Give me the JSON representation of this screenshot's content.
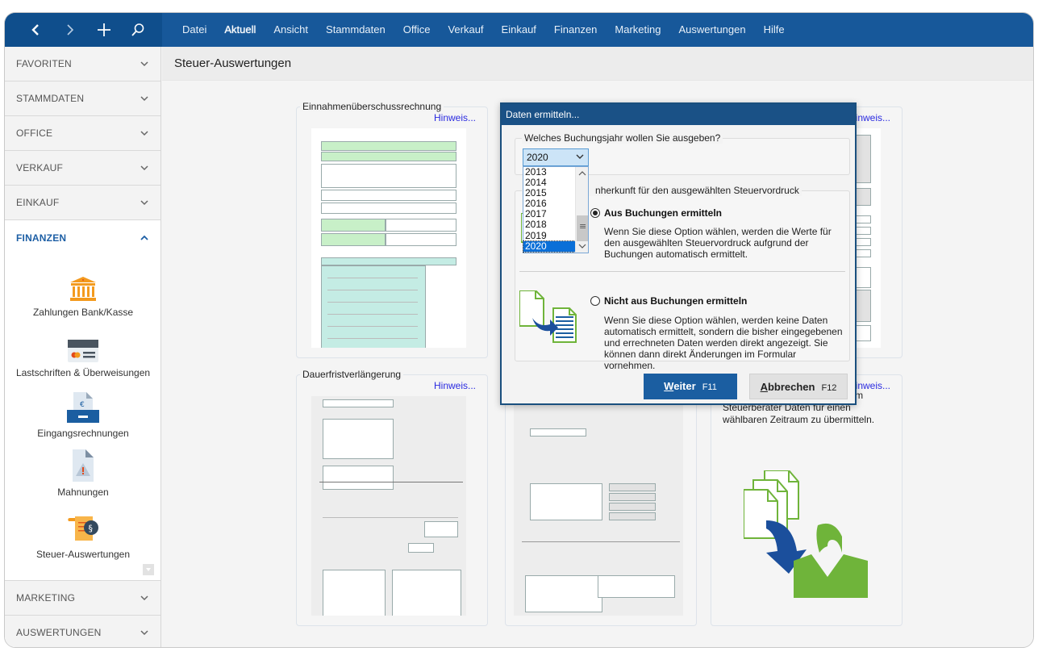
{
  "toolbar": {
    "nav_icons": [
      "back-icon",
      "forward-icon",
      "plus-icon",
      "search-icon"
    ],
    "menu": [
      "Datei",
      "Aktuell",
      "Ansicht",
      "Stammdaten",
      "Office",
      "Verkauf",
      "Einkauf",
      "Finanzen",
      "Marketing",
      "Auswertungen",
      "Hilfe"
    ],
    "active_menu": "Aktuell"
  },
  "sidebar": {
    "sections_top": [
      {
        "label": "FAVORITEN",
        "state": "collapsed"
      },
      {
        "label": "STAMMDATEN",
        "state": "collapsed"
      },
      {
        "label": "OFFICE",
        "state": "collapsed"
      },
      {
        "label": "VERKAUF",
        "state": "collapsed"
      },
      {
        "label": "EINKAUF",
        "state": "collapsed"
      }
    ],
    "open_section": {
      "label": "FINANZEN",
      "state": "expanded"
    },
    "finance_items": [
      {
        "label": "Zahlungen Bank/Kasse",
        "icon": "bank-icon"
      },
      {
        "label": "Lastschriften & Überweisungen",
        "icon": "credit-card-icon"
      },
      {
        "label": "Eingangsrechnungen",
        "icon": "invoice-inbox-icon"
      },
      {
        "label": "Mahnungen",
        "icon": "warning-document-icon"
      },
      {
        "label": "Steuer-Auswertungen",
        "icon": "tax-scroll-icon"
      }
    ],
    "sections_bottom": [
      {
        "label": "MARKETING",
        "state": "collapsed"
      },
      {
        "label": "AUSWERTUNGEN",
        "state": "collapsed"
      }
    ]
  },
  "page": {
    "title": "Steuer-Auswertungen",
    "cards": [
      {
        "title": "Einnahmenüberschussrechnung",
        "hint": "Hinweis..."
      },
      {
        "title": "",
        "hint": "Hinweis..."
      },
      {
        "title": "Dauerfristverlängerung",
        "hint": "Hinweis..."
      },
      {
        "title": "",
        "hint": ""
      },
      {
        "title": "",
        "hint": "Hinweis...",
        "text": "haben Sie die Möglichkeit, Ihrem Steuerberater Daten für einen wählbaren Zeitraum zu übermitteln.",
        "text_partial_hidden": "…er"
      }
    ]
  },
  "dialog": {
    "title": "Daten ermitteln...",
    "year_group_label": "Welches Buchungsjahr wollen Sie ausgeben?",
    "year_selected": "2020",
    "year_options": [
      "2013",
      "2014",
      "2015",
      "2016",
      "2017",
      "2018",
      "2019",
      "2020"
    ],
    "source_group_label": "Datenherkunft für den ausgewählten Steuervordruck",
    "source_group_label_visible": "nherkunft für den ausgewählten Steuervordruck",
    "source_group_label_prefix": "A",
    "option1": {
      "label": "Aus Buchungen ermitteln",
      "selected": true,
      "description": "Wenn Sie diese Option wählen, werden die Werte für den ausgewählten Steuervordruck aufgrund der Buchungen automatisch ermittelt."
    },
    "option2": {
      "label": "Nicht aus Buchungen ermitteln",
      "selected": false,
      "description": "Wenn Sie diese Option wählen, werden keine Daten automatisch ermittelt, sondern die bisher eingegebenen und errechneten Daten werden direkt angezeigt. Sie können dann direkt Änderungen im Formular vornehmen."
    },
    "buttons": {
      "next": {
        "mnemonic": "W",
        "rest": "eiter",
        "key": "F11"
      },
      "cancel": {
        "mnemonic": "A",
        "rest": "bbrechen",
        "key": "F12"
      }
    }
  },
  "colors": {
    "topbar": "#17589a",
    "navbox": "#0f4e8c",
    "accent": "#1d5fa5",
    "dialog_title": "#1a5186",
    "hint_link": "#2a2ae0",
    "selection": "#0a6fd8",
    "green": "#6fb43a",
    "orange": "#f39a1e"
  }
}
